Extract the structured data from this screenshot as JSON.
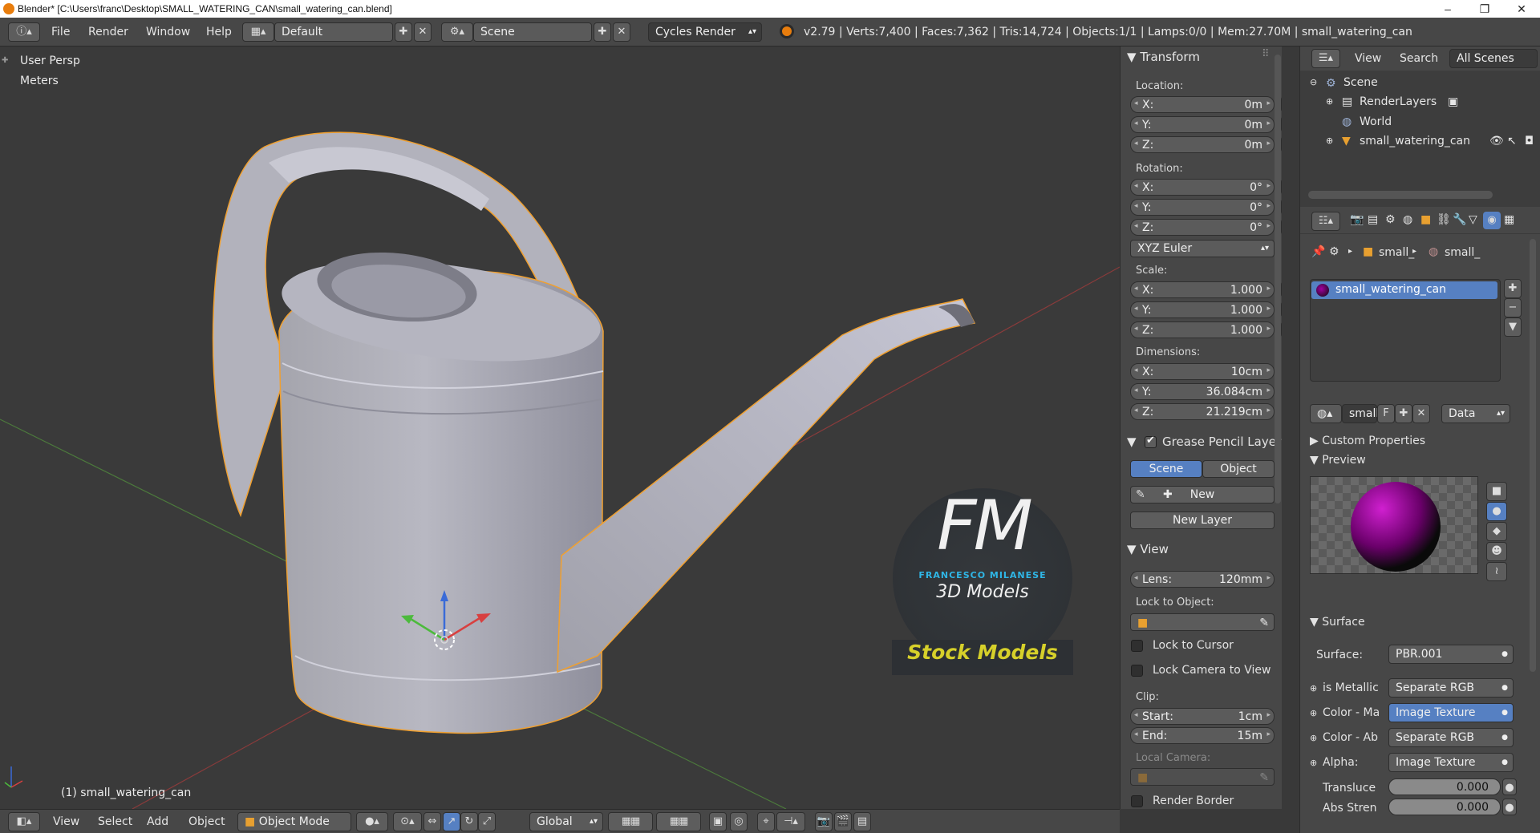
{
  "window": {
    "title": "Blender* [C:\\Users\\franc\\Desktop\\SMALL_WATERING_CAN\\small_watering_can.blend]",
    "minimize": "–",
    "maximize": "❐",
    "close": "✕"
  },
  "topbar": {
    "menus": [
      "File",
      "Render",
      "Window",
      "Help"
    ],
    "layout": "Default",
    "scene": "Scene",
    "engine": "Cycles Render",
    "stats": "v2.79 | Verts:7,400 | Faces:7,362 | Tris:14,724 | Objects:1/1 | Lamps:0/0 | Mem:27.70M | small_watering_can"
  },
  "viewport": {
    "view_name": "User Persp",
    "units": "Meters",
    "object_label": "(1) small_watering_can",
    "watermark": {
      "logo": "FM",
      "author": "FRANCESCO MILANESE",
      "sub": "3D Models",
      "tag": "Stock Models"
    }
  },
  "npanel": {
    "transform": {
      "title": "Transform",
      "location_label": "Location:",
      "location": [
        {
          "k": "X:",
          "v": "0m"
        },
        {
          "k": "Y:",
          "v": "0m"
        },
        {
          "k": "Z:",
          "v": "0m"
        }
      ],
      "rotation_label": "Rotation:",
      "rotation": [
        {
          "k": "X:",
          "v": "0°"
        },
        {
          "k": "Y:",
          "v": "0°"
        },
        {
          "k": "Z:",
          "v": "0°"
        }
      ],
      "rotation_mode": "XYZ Euler",
      "scale_label": "Scale:",
      "scale": [
        {
          "k": "X:",
          "v": "1.000"
        },
        {
          "k": "Y:",
          "v": "1.000"
        },
        {
          "k": "Z:",
          "v": "1.000"
        }
      ],
      "dimensions_label": "Dimensions:",
      "dimensions": [
        {
          "k": "X:",
          "v": "10cm"
        },
        {
          "k": "Y:",
          "v": "36.084cm"
        },
        {
          "k": "Z:",
          "v": "21.219cm"
        }
      ]
    },
    "grease": {
      "title": "Grease Pencil Layer",
      "scene_btn": "Scene",
      "object_btn": "Object",
      "new_btn": "New",
      "new_layer_btn": "New Layer"
    },
    "view": {
      "title": "View",
      "lens_k": "Lens:",
      "lens_v": "120mm",
      "lock_to_object": "Lock to Object:",
      "lock_to_cursor": "Lock to Cursor",
      "lock_camera": "Lock Camera to View",
      "clip_label": "Clip:",
      "clip_start_k": "Start:",
      "clip_start_v": "1cm",
      "clip_end_k": "End:",
      "clip_end_v": "15m",
      "local_camera": "Local Camera:",
      "render_border": "Render Border"
    }
  },
  "outliner": {
    "view": "View",
    "search": "Search",
    "filter": "All Scenes",
    "items": [
      {
        "label": "Scene"
      },
      {
        "label": "RenderLayers"
      },
      {
        "label": "World"
      },
      {
        "label": "small_watering_can"
      }
    ]
  },
  "properties": {
    "breadcrumb_obj": "small_",
    "breadcrumb_mat": "small_",
    "material_slot": "small_watering_can",
    "mat_name": "small",
    "mat_fake": "F",
    "link": "Data",
    "custom_props": "Custom Properties",
    "preview": "Preview",
    "surface_title": "Surface",
    "surface_label": "Surface:",
    "surface_value": "PBR.001",
    "inputs": [
      {
        "label": "is Metallic",
        "value": "Separate RGB"
      },
      {
        "label": "Color - Ma",
        "value": "Image Texture"
      },
      {
        "label": "Color - Ab",
        "value": "Separate RGB"
      },
      {
        "label": "Alpha:",
        "value": "Image Texture"
      }
    ],
    "translucent_label": "Transluce",
    "translucent_value": "0.000",
    "abs_label": "Abs Stren",
    "abs_value": "0.000"
  },
  "bottombar": {
    "menus": [
      "View",
      "Select",
      "Add",
      "Object"
    ],
    "mode": "Object Mode",
    "orientation": "Global"
  },
  "colors": {
    "accent_blue": "#5680c2",
    "selection_orange": "#f0a030",
    "watermark_cyan": "#2fb6e6",
    "watermark_yellow": "#d6d02a"
  }
}
